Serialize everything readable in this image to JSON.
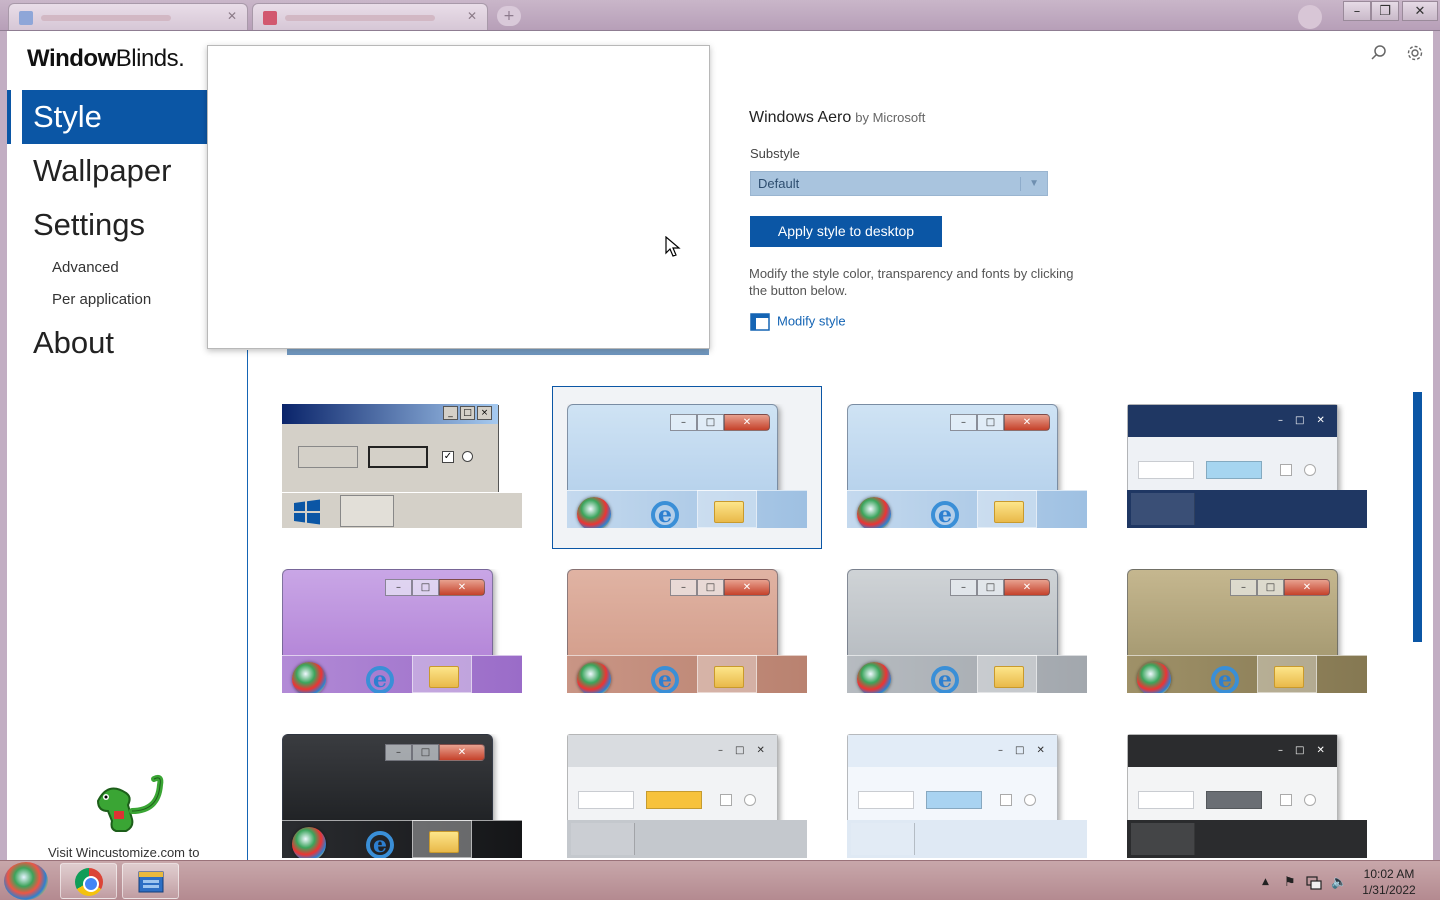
{
  "browser": {
    "tab1_label": "",
    "tab2_label": "",
    "new_tab": "+",
    "min": "–",
    "max": "❐",
    "close": "✕"
  },
  "app": {
    "logo_bold": "Window",
    "logo_light": "Blinds",
    "logo_mark": "."
  },
  "nav": {
    "style": "Style",
    "wallpaper": "Wallpaper",
    "settings": "Settings",
    "advanced": "Advanced",
    "per_application": "Per application",
    "about": "About"
  },
  "sidebar": {
    "visit_text": "Visit Wincustomize.com to"
  },
  "style_info": {
    "name": "Windows Aero",
    "author": "by Microsoft",
    "substyle_label": "Substyle",
    "substyle_value": "Default",
    "apply_label": "Apply style to desktop",
    "description": "Modify the style color, transparency and fonts by clicking the button below.",
    "modify_label": "Modify style"
  },
  "thumbnails": [
    {
      "theme": "classic",
      "selected": false
    },
    {
      "theme": "aero-blue",
      "selected": true
    },
    {
      "theme": "aero-blue",
      "selected": false
    },
    {
      "theme": "dark-navy",
      "selected": false
    },
    {
      "theme": "lilac",
      "selected": false
    },
    {
      "theme": "rose-stone",
      "selected": false
    },
    {
      "theme": "silver",
      "selected": false
    },
    {
      "theme": "gold-brushed",
      "selected": false
    },
    {
      "theme": "carbon",
      "selected": false
    },
    {
      "theme": "light-gray-flat",
      "selected": false
    },
    {
      "theme": "light-blue-flat",
      "selected": false
    },
    {
      "theme": "dark-flat",
      "selected": false
    }
  ],
  "taskbar": {
    "time": "10:02 AM",
    "date": "1/31/2022",
    "tray_up": "▲",
    "flag": "⚑",
    "volume": "🔈"
  },
  "colors": {
    "accent": "#0b56a5",
    "link": "#1464b4",
    "select_bg": "#a9c4de"
  }
}
